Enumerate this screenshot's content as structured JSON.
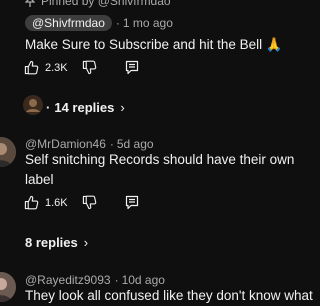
{
  "comments": [
    {
      "pinned_label": "Pinned by @Shivfrmdao",
      "author": "@Shivfrmdao",
      "time": "1 mo ago",
      "text": "Make Sure to Subscribe and hit the Bell 🙏",
      "likes": "2.3K",
      "replies_label": "14 replies"
    },
    {
      "author": "@MrDamion46",
      "time": "5d ago",
      "text_line1": "Self snitching Records should have their own",
      "text_line2": "label",
      "likes": "1.6K",
      "replies_label": "8 replies"
    },
    {
      "author": "@Rayeditz9093",
      "time": "10d ago",
      "text": "They look all confused like they don't know what"
    }
  ],
  "icons": {
    "like": "thumbs-up-icon",
    "dislike": "thumbs-down-icon",
    "reply": "reply-icon",
    "pin": "pin-icon",
    "chevron": "chevron-right-icon"
  },
  "colors": {
    "background": "#0f0f0f",
    "text": "#f1f1f1",
    "muted": "#aaaaaa",
    "author_chip": "#3d3d3d"
  }
}
